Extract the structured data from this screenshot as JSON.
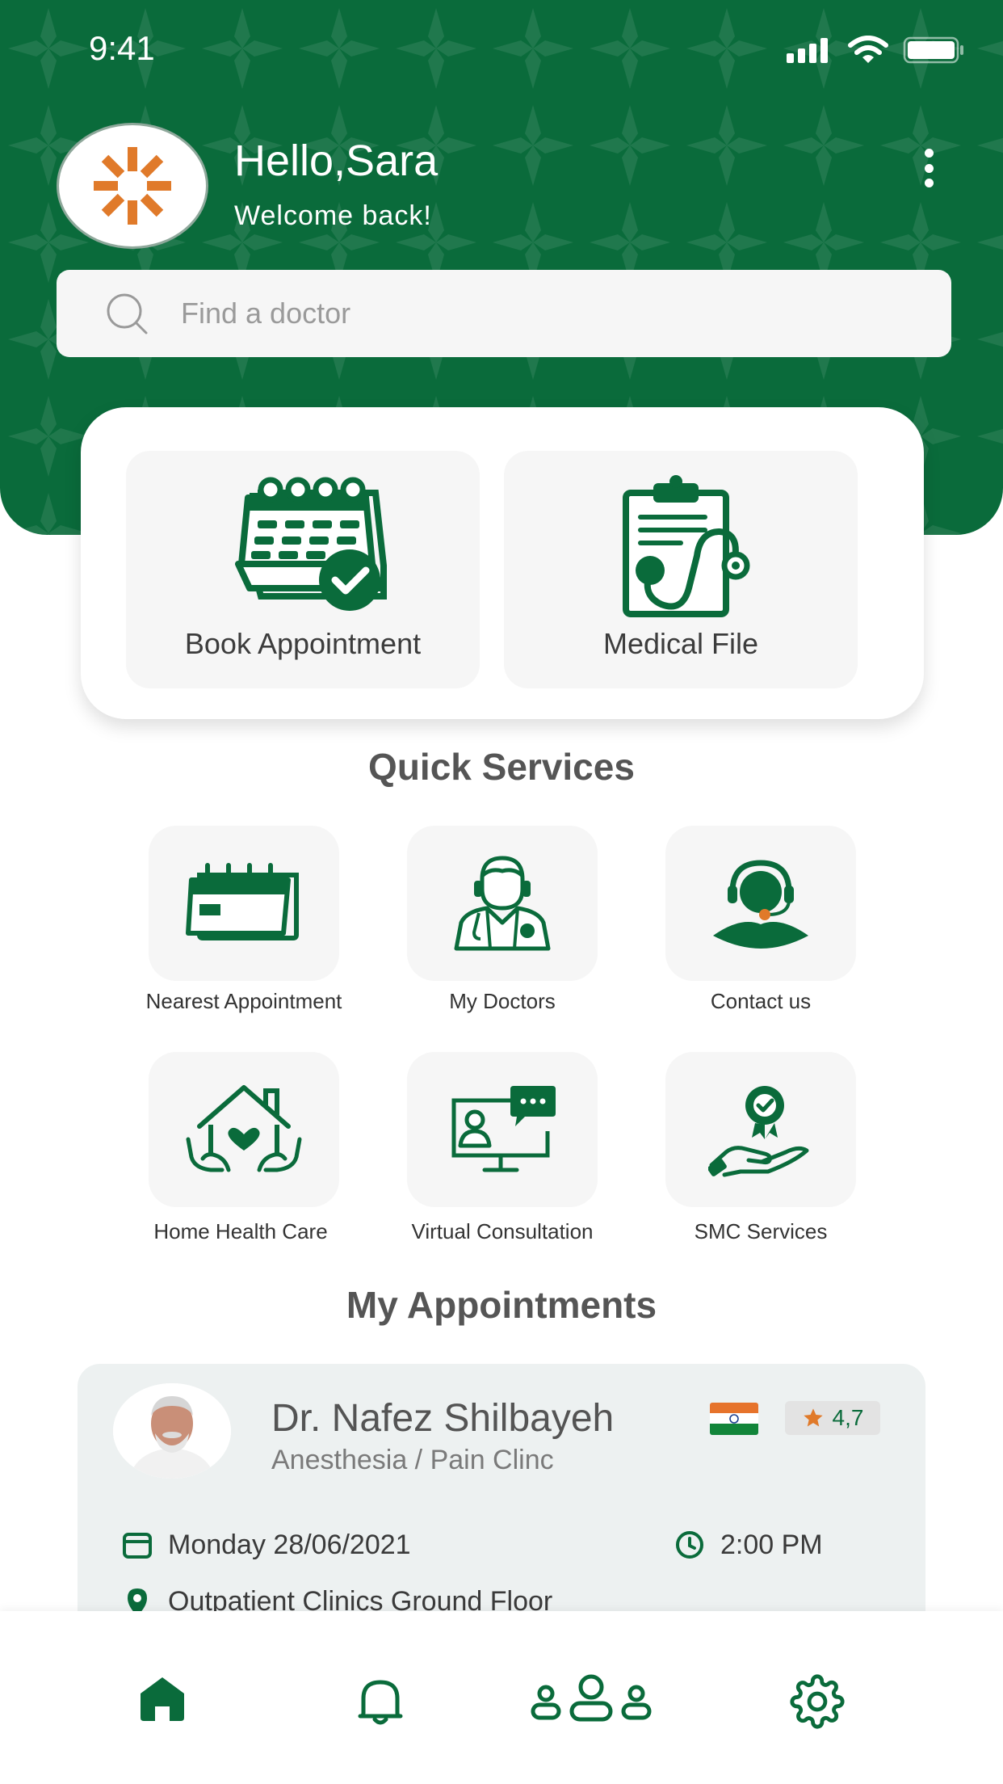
{
  "status_bar": {
    "time": "9:41"
  },
  "header": {
    "greeting": "Hello,Sara",
    "subtitle": "Welcome back!"
  },
  "search": {
    "placeholder": "Find a doctor",
    "value": ""
  },
  "main_actions": [
    {
      "label": "Book Appointment",
      "icon": "calendar-check-icon"
    },
    {
      "label": "Medical File",
      "icon": "clipboard-stethoscope-icon"
    }
  ],
  "quick_services": {
    "title": "Quick Services",
    "items": [
      {
        "label": "Nearest Appointment",
        "icon": "calendar-card-icon"
      },
      {
        "label": "My Doctors",
        "icon": "doctor-icon"
      },
      {
        "label": "Contact us",
        "icon": "headset-agent-icon"
      },
      {
        "label": "Home Health Care",
        "icon": "home-heart-icon"
      },
      {
        "label": "Virtual Consultation",
        "icon": "video-consult-icon"
      },
      {
        "label": "SMC Services",
        "icon": "badge-hand-icon"
      }
    ]
  },
  "appointments": {
    "title": "My Appointments",
    "items": [
      {
        "doctor": "Dr. Nafez Shilbayeh",
        "specialty": "Anesthesia / Pain Clinc",
        "rating": "4,7",
        "date": "Monday 28/06/2021",
        "time": "2:00 PM",
        "location": "Outpatient Clinics Ground Floor"
      }
    ]
  },
  "bottom_nav": [
    {
      "name": "home",
      "icon": "home-icon",
      "active": true
    },
    {
      "name": "notifications",
      "icon": "bell-icon",
      "active": false
    },
    {
      "name": "family",
      "icon": "people-icon",
      "active": false
    },
    {
      "name": "settings",
      "icon": "gear-icon",
      "active": false
    }
  ],
  "colors": {
    "primary": "#0a6b3b",
    "accent": "#e07a2a",
    "card_bg": "#f6f6f6",
    "appointment_bg": "#edf1f1"
  }
}
